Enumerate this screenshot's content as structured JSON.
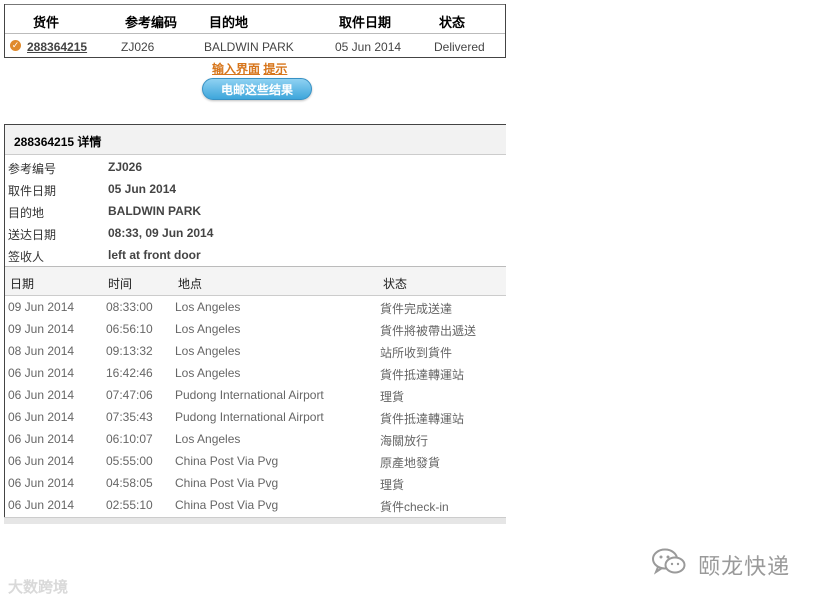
{
  "summary": {
    "headers": {
      "shipment": "货件",
      "reference": "参考编码",
      "destination": "目的地",
      "pickup_date": "取件日期",
      "status": "状态"
    },
    "row": {
      "tracking_number": "288364215",
      "reference": "ZJ026",
      "destination": "BALDWIN PARK",
      "pickup_date": "05 Jun 2014",
      "status": "Delivered"
    }
  },
  "actions": {
    "input_screen": "输入界面",
    "hint": "提示",
    "email_button": "电邮这些结果"
  },
  "detail": {
    "title": "288364215 详情",
    "info": [
      {
        "label": "参考编号",
        "value": "ZJ026"
      },
      {
        "label": "取件日期",
        "value": "05 Jun 2014"
      },
      {
        "label": "目的地",
        "value": "BALDWIN PARK"
      },
      {
        "label": "送达日期",
        "value": "08:33, 09 Jun 2014"
      },
      {
        "label": "签收人",
        "value": "left at front door"
      }
    ],
    "event_headers": {
      "date": "日期",
      "time": "时间",
      "location": "地点",
      "status": "状态"
    },
    "events": [
      {
        "date": "09 Jun 2014",
        "time": "08:33:00",
        "location": "Los Angeles",
        "status": "貨件完成送達"
      },
      {
        "date": "09 Jun 2014",
        "time": "06:56:10",
        "location": "Los Angeles",
        "status": "貨件將被帶出遞送"
      },
      {
        "date": "08 Jun 2014",
        "time": "09:13:32",
        "location": "Los Angeles",
        "status": "站所收到貨件"
      },
      {
        "date": "06 Jun 2014",
        "time": "16:42:46",
        "location": "Los Angeles",
        "status": "貨件抵達轉運站"
      },
      {
        "date": "06 Jun 2014",
        "time": "07:47:06",
        "location": "Pudong International Airport",
        "status": "理貨"
      },
      {
        "date": "06 Jun 2014",
        "time": "07:35:43",
        "location": "Pudong International Airport",
        "status": "貨件抵達轉運站"
      },
      {
        "date": "06 Jun 2014",
        "time": "06:10:07",
        "location": "Los Angeles",
        "status": "海關放行"
      },
      {
        "date": "06 Jun 2014",
        "time": "05:55:00",
        "location": "China Post Via Pvg",
        "status": "原產地發貨"
      },
      {
        "date": "06 Jun 2014",
        "time": "04:58:05",
        "location": "China Post Via Pvg",
        "status": "理貨"
      },
      {
        "date": "06 Jun 2014",
        "time": "02:55:10",
        "location": "China Post Via Pvg",
        "status": "貨件check-in"
      }
    ]
  },
  "watermarks": {
    "left": "大数跨境",
    "right": "颐龙快递"
  },
  "icons": {
    "check": "check-circle-icon",
    "wechat": "wechat-icon"
  },
  "colors": {
    "link_orange": "#d7761c",
    "button_blue": "#3ea6db"
  }
}
